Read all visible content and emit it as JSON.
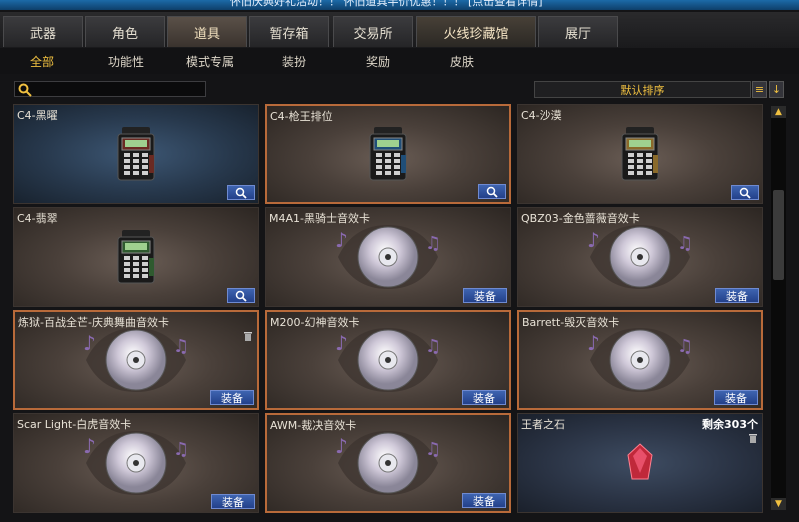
{
  "banner": "怀旧庆典好礼活动！！ 怀旧道具半价优惠！！！ [点击查看详情]",
  "tabs": [
    "武器",
    "角色",
    "道具",
    "暂存箱",
    "交易所",
    "火线珍藏馆",
    "展厅"
  ],
  "active_tab": "道具",
  "subtabs": [
    "全部",
    "功能性",
    "模式专属",
    "装扮",
    "奖励",
    "皮肤"
  ],
  "active_subtab": "全部",
  "search": {
    "value": ""
  },
  "sort_label": "默认排序",
  "equip_label": "装备",
  "items": [
    {
      "name": "C4-黑曜",
      "type": "c4",
      "color": "#6a2a22",
      "action": "magnify"
    },
    {
      "name": "C4-枪王排位",
      "type": "c4",
      "color": "#1f4e78",
      "action": "magnify",
      "selected": true
    },
    {
      "name": "C4-沙漠",
      "type": "c4",
      "color": "#8a6a2a",
      "action": "magnify"
    },
    {
      "name": "C4-翡翠",
      "type": "c4",
      "color": "#2f5a2f",
      "action": "magnify"
    },
    {
      "name": "M4A1-黑骑士音效卡",
      "type": "disc",
      "action": "equip"
    },
    {
      "name": "QBZ03-金色蔷薇音效卡",
      "type": "disc",
      "action": "equip"
    },
    {
      "name": "炼狱-百战全芒-庆典舞曲音效卡",
      "type": "disc",
      "action": "equip",
      "trash": true,
      "selected": true
    },
    {
      "name": "M200-幻神音效卡",
      "type": "disc",
      "action": "equip",
      "selected": true
    },
    {
      "name": "Barrett-毁灭音效卡",
      "type": "disc",
      "action": "equip",
      "selected": true
    },
    {
      "name": "Scar Light-白虎音效卡",
      "type": "disc",
      "action": "equip"
    },
    {
      "name": "AWM-裁决音效卡",
      "type": "disc",
      "action": "equip",
      "selected": true
    },
    {
      "name": "王者之石",
      "type": "gem",
      "remaining": "剩余303个",
      "trash": true
    }
  ],
  "colors": {
    "accent": "#f0c040",
    "button": "#2e52a0",
    "selected_border": "#b86a3a"
  }
}
